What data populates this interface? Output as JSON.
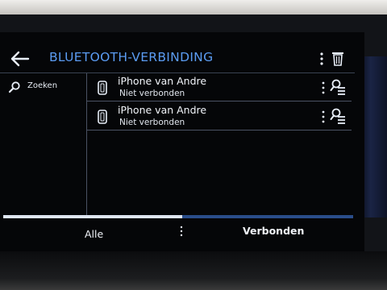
{
  "header": {
    "title": "BLUETOOTH-VERBINDING",
    "back_icon": "arrow-left-icon",
    "menu_icon": "vertical-dots-icon",
    "delete_icon": "trash-icon"
  },
  "sidebar": {
    "search_label": "Zoeken",
    "search_icon": "magnifier-icon"
  },
  "devices": [
    {
      "name": "iPhone van Andre",
      "status": "Niet verbonden",
      "icon": "phone-icon",
      "action_icon": "search-list-icon"
    },
    {
      "name": "iPhone van Andre",
      "status": "Niet verbonden",
      "icon": "phone-icon",
      "action_icon": "search-list-icon"
    }
  ],
  "tabs": [
    {
      "label": "Alle",
      "active": true
    },
    {
      "label": "Verbonden",
      "active": false
    }
  ],
  "colors": {
    "accent": "#5b9cf3",
    "background": "#050608",
    "text": "#f2f5fa",
    "tab_track": "#2a4d8a"
  }
}
